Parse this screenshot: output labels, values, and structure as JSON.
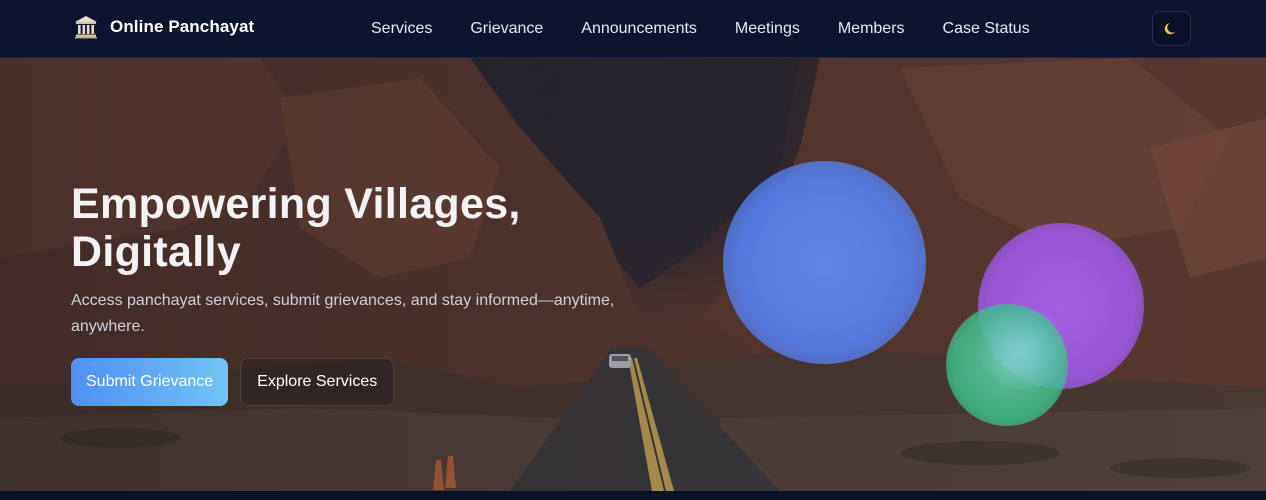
{
  "brand": {
    "icon": "bank-building-icon",
    "name": "Online Panchayat"
  },
  "nav": {
    "links": [
      {
        "label": "Services"
      },
      {
        "label": "Grievance"
      },
      {
        "label": "Announcements"
      },
      {
        "label": "Meetings"
      },
      {
        "label": "Members"
      },
      {
        "label": "Case Status"
      }
    ],
    "theme_toggle_icon": "crescent-moon-icon"
  },
  "hero": {
    "title": "Empowering Villages, Digitally",
    "subtitle": "Access panchayat services, submit grievances, and stay informed—anytime, anywhere.",
    "primary_button": "Submit Grievance",
    "secondary_button": "Explore Services",
    "background": "desert-canyon-road-photo"
  },
  "colors": {
    "nav_background": "#0c1430",
    "primary_gradient_start": "#4f8ff4",
    "primary_gradient_end": "#72c4f4",
    "orb_blue": "#5c86f2",
    "orb_purple": "#a35ced",
    "orb_green": "#3ebe8c"
  }
}
